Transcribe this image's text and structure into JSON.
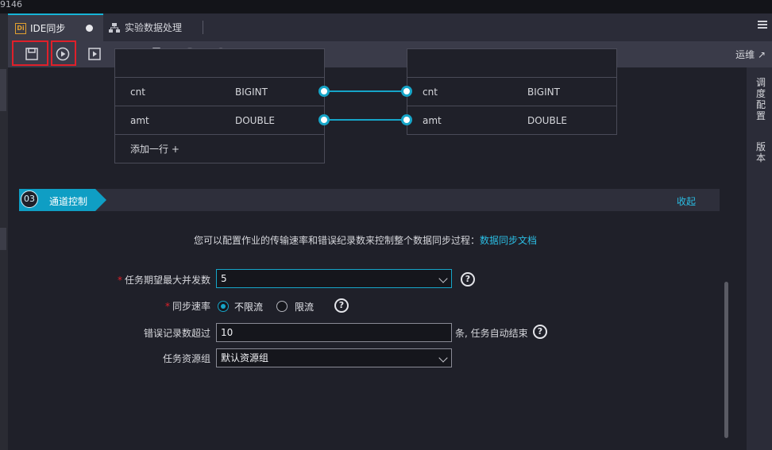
{
  "top_strip": {
    "number": "9146"
  },
  "tabs": [
    {
      "label": "IDE同步",
      "icon": "di-icon",
      "active": true
    },
    {
      "label": "实验数据处理",
      "icon": "flow-icon",
      "active": false
    }
  ],
  "toolbar": {
    "buttons": [
      "save",
      "run",
      "run-with-params",
      "submit",
      "deploy",
      "stop",
      "lock",
      "code-view"
    ],
    "ops_label": "运维",
    "ops_arrow": "↗"
  },
  "mapping": {
    "source_rows": [
      {
        "name": "cnt",
        "type": "BIGINT"
      },
      {
        "name": "amt",
        "type": "DOUBLE"
      }
    ],
    "target_rows": [
      {
        "name": "cnt",
        "type": "BIGINT"
      },
      {
        "name": "amt",
        "type": "DOUBLE"
      }
    ],
    "add_row_label": "添加一行 +"
  },
  "section": {
    "number": "03",
    "title": "通道控制",
    "collapse_label": "收起"
  },
  "description": {
    "text": "您可以配置作业的传输速率和错误纪录数来控制整个数据同步过程：",
    "link": "数据同步文档"
  },
  "form": {
    "concurrency": {
      "label": "任务期望最大并发数",
      "value": "5",
      "required": true
    },
    "sync_rate": {
      "label": "同步速率",
      "required": true,
      "options": [
        "不限流",
        "限流"
      ],
      "selected": "不限流"
    },
    "error_limit": {
      "label": "错误记录数超过",
      "value": "10",
      "suffix": "条, 任务自动结束"
    },
    "resource_group": {
      "label": "任务资源组",
      "value": "默认资源组"
    }
  },
  "right_panel": {
    "items": [
      "调度配置",
      "版本"
    ]
  },
  "colors": {
    "accent": "#16a5c8",
    "highlight_box": "#e0202a",
    "background": "#1f2029"
  }
}
